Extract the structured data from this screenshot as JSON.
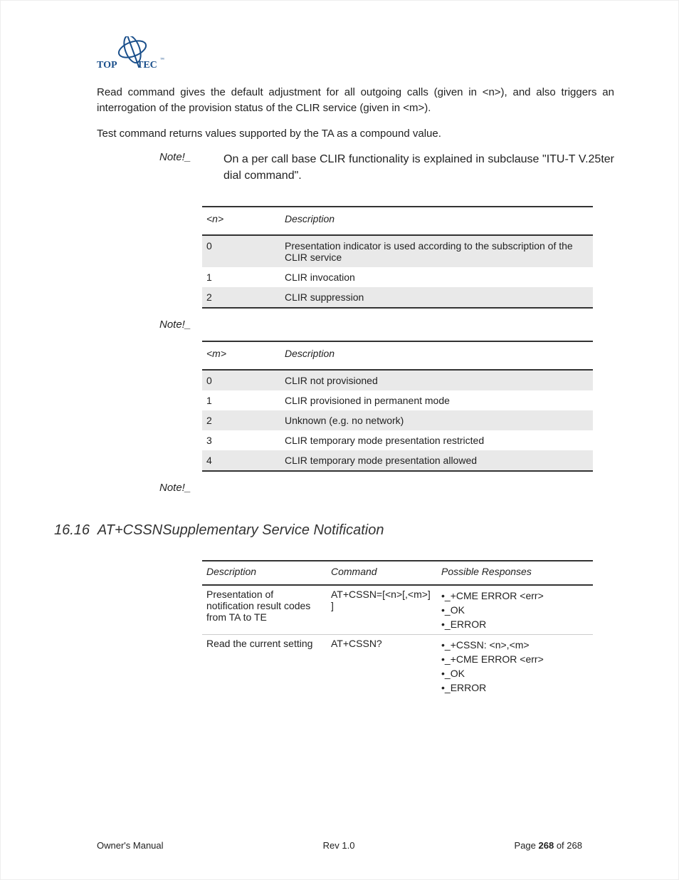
{
  "logo": {
    "brand_left": "TOP",
    "brand_right": "TEC"
  },
  "paragraphs": {
    "p1": "Read command gives the default adjustment for all outgoing calls (given in <n>), and also triggers an interrogation of the provision status of the CLIR service (given in <m>).",
    "p2": "Test command returns values supported by the TA as a compound value."
  },
  "note_main": {
    "label": "Note!_",
    "body": "On a per call base CLIR functionality is explained in subclause \"ITU-T V.25ter dial command\"."
  },
  "table_n": {
    "headers": [
      "<n>",
      "Description"
    ],
    "rows": [
      {
        "k": "0",
        "d": "Presentation indicator is used according to the subscription of the CLIR service",
        "alt": true
      },
      {
        "k": "1",
        "d": "CLIR invocation",
        "alt": false
      },
      {
        "k": "2",
        "d": "CLIR suppression",
        "alt": true
      }
    ]
  },
  "note2": "Note!_",
  "table_m": {
    "headers": [
      "<m>",
      "Description"
    ],
    "rows": [
      {
        "k": "0",
        "d": "CLIR not provisioned",
        "alt": true
      },
      {
        "k": "1",
        "d": "CLIR provisioned in permanent mode",
        "alt": false
      },
      {
        "k": "2",
        "d": "Unknown (e.g. no network)",
        "alt": true
      },
      {
        "k": "3",
        "d": "CLIR temporary mode presentation restricted",
        "alt": false
      },
      {
        "k": "4",
        "d": "CLIR temporary mode presentation allowed",
        "alt": true
      }
    ]
  },
  "note3": "Note!_",
  "section": {
    "num": "16.16",
    "title": "AT+CSSNSupplementary Service Notification"
  },
  "cmd_table": {
    "headers": [
      "Description",
      "Command",
      "Possible Responses"
    ],
    "rows": [
      {
        "desc": "Presentation of notification result codes from TA to TE",
        "cmd": "AT+CSSN=[<n>[,<m>] ]",
        "resp": [
          "+CME ERROR <err>",
          "OK",
          "ERROR"
        ]
      },
      {
        "desc": "Read the current setting",
        "cmd": "AT+CSSN?",
        "resp": [
          "+CSSN: <n>,<m>",
          "+CME ERROR <err>",
          "OK",
          "ERROR"
        ]
      }
    ]
  },
  "footer": {
    "left": "Owner's Manual",
    "center": "Rev 1.0",
    "right_prefix": "Page ",
    "right_page": "268",
    "right_suffix": " of 268"
  }
}
